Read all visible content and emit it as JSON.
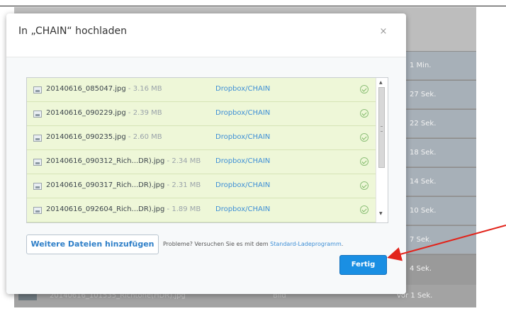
{
  "background": {
    "rows": [
      {
        "time": "1 Min."
      },
      {
        "time": "27 Sek."
      },
      {
        "time": "22 Sek."
      },
      {
        "time": "18 Sek."
      },
      {
        "time": "14 Sek."
      },
      {
        "time": "10 Sek."
      },
      {
        "time": "7 Sek."
      },
      {
        "time": "4 Sek."
      }
    ],
    "bottom_row": {
      "name": "20140616_101535_Richtone(HDR).jpg",
      "kind": "Bild",
      "time": "vor 1 Sek."
    }
  },
  "dialog": {
    "title": "In „CHAIN“ hochladen",
    "close": "×",
    "files": [
      {
        "name": "20140616_085047.jpg",
        "size": " - 3.16 MB",
        "dest": "Dropbox/CHAIN",
        "icon": "image-file-icon"
      },
      {
        "name": "20140616_090229.jpg",
        "size": " - 2.39 MB",
        "dest": "Dropbox/CHAIN",
        "icon": "image-file-icon"
      },
      {
        "name": "20140616_090235.jpg",
        "size": " - 2.60 MB",
        "dest": "Dropbox/CHAIN",
        "icon": "image-file-icon"
      },
      {
        "name": "20140616_090312_Rich...DR).jpg",
        "size": " - 2.34 MB",
        "dest": "Dropbox/CHAIN",
        "icon": "image-file-icon"
      },
      {
        "name": "20140616_090317_Rich...DR).jpg",
        "size": " - 2.31 MB",
        "dest": "Dropbox/CHAIN",
        "icon": "image-file-icon"
      },
      {
        "name": "20140616_092604_Rich...DR).jpg",
        "size": " - 1.89 MB",
        "dest": "Dropbox/CHAIN",
        "icon": "image-file-icon"
      }
    ],
    "add_more_label": "Weitere Dateien hinzufügen",
    "hint_text": "Probleme? Versuchen Sie es mit dem ",
    "hint_link": "Standard-Ladeprogramm",
    "hint_end": ".",
    "done_label": "Fertig"
  },
  "colors": {
    "accent": "#1a8fe3",
    "success": "#7ab762",
    "annotation": "#e2231a"
  }
}
